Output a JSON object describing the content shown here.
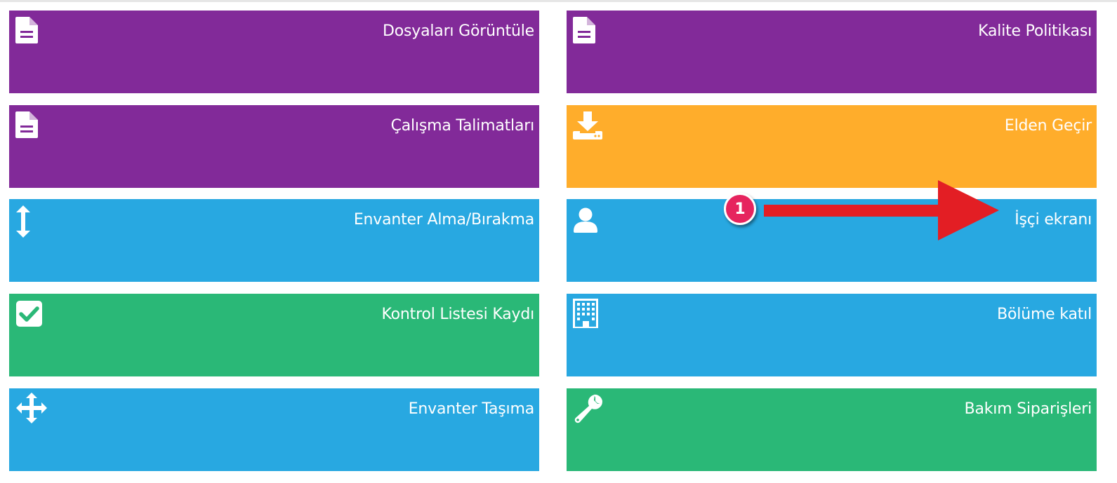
{
  "tiles": [
    {
      "label": "Dosyaları Görüntüle",
      "color": "#822a99",
      "icon": "document-icon"
    },
    {
      "label": "Kalite Politikası",
      "color": "#822a99",
      "icon": "document-icon"
    },
    {
      "label": "Çalışma Talimatları",
      "color": "#822a99",
      "icon": "document-icon"
    },
    {
      "label": "Elden Geçir",
      "color": "#ffad2b",
      "icon": "download-tray-icon"
    },
    {
      "label": "Envanter Alma/Bırakma",
      "color": "#28a8e1",
      "icon": "vertical-arrows-icon"
    },
    {
      "label": "İşçi ekranı",
      "color": "#28a8e1",
      "icon": "user-icon"
    },
    {
      "label": "Kontrol Listesi Kaydı",
      "color": "#2ab877",
      "icon": "checkbox-icon"
    },
    {
      "label": "Bölüme katıl",
      "color": "#28a8e1",
      "icon": "building-icon"
    },
    {
      "label": "Envanter Taşıma",
      "color": "#28a8e1",
      "icon": "move-arrows-icon"
    },
    {
      "label": "Bakım Siparişleri",
      "color": "#2ab877",
      "icon": "wrench-icon"
    }
  ],
  "annotation": {
    "badge_number": "1",
    "badge_color": "#e6245e",
    "arrow_color": "#e31e24",
    "points_to": "İşçi ekranı"
  }
}
